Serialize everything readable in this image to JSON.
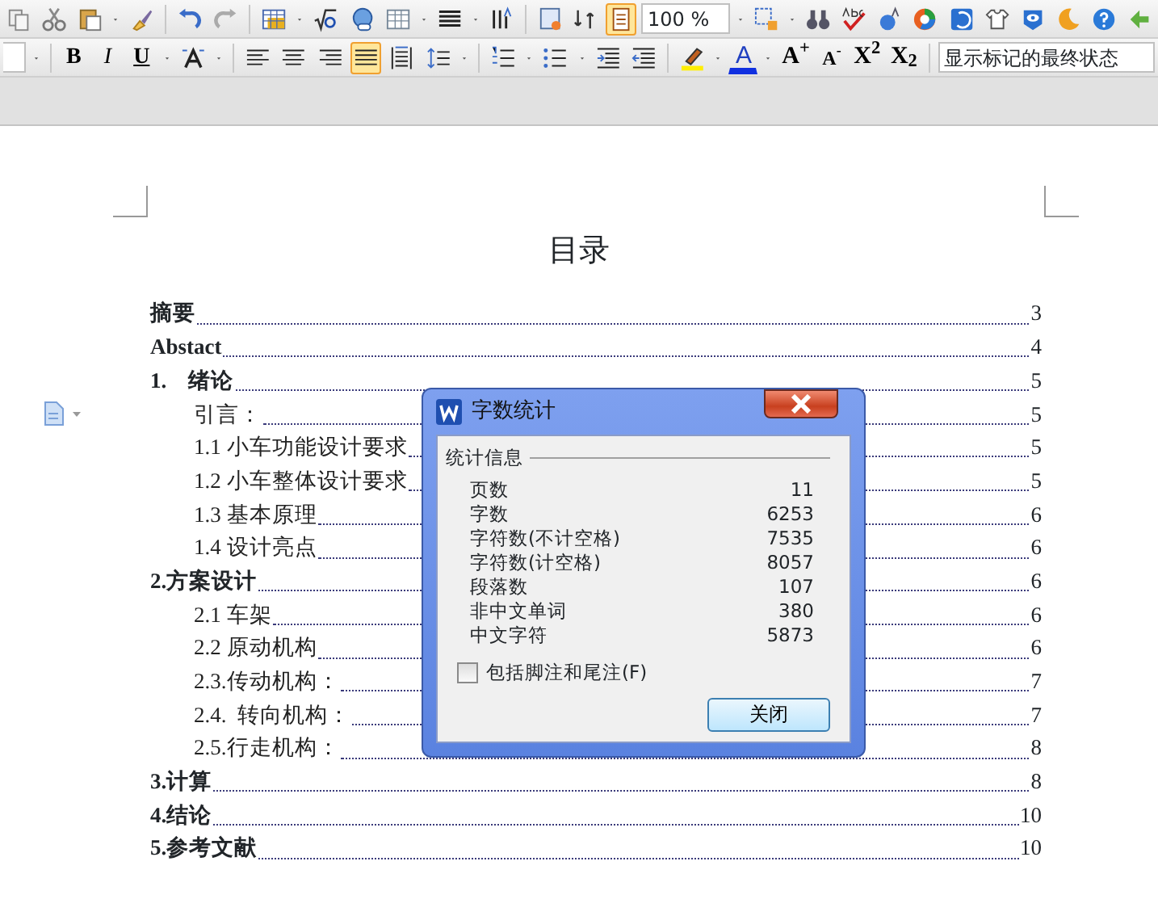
{
  "toolbar_1": {
    "zoom": "100 %"
  },
  "toolbar_2": {
    "format_buttons": [
      {
        "label": "B",
        "kind": "bold"
      },
      {
        "label": "I",
        "kind": "italic"
      },
      {
        "label": "U",
        "kind": "underline"
      }
    ],
    "justify_selected": true,
    "size_buttons": [
      {
        "label": "A$^{+}$"
      },
      {
        "label": "A$^{-}$"
      },
      {
        "label": "X$^{2}$"
      },
      {
        "label": "X$_{2}$"
      }
    ],
    "color_label": "A",
    "markup_view": "显示标记的最终状态"
  },
  "document": {
    "title": "目录",
    "toc": [
      {
        "text": "摘要",
        "page": "3",
        "kind": "heading"
      },
      {
        "text": "Abstact",
        "page": "4",
        "kind": "heading"
      },
      {
        "text": "1.    绪论",
        "page": "5",
        "kind": "heading"
      },
      {
        "text": "引言：",
        "page": "5",
        "kind": "sub"
      },
      {
        "text": "1.1 小车功能设计要求",
        "page": "5",
        "kind": "sub"
      },
      {
        "text": "1.2 小车整体设计要求",
        "page": "5",
        "kind": "sub"
      },
      {
        "text": "1.3 基本原理",
        "page": "6",
        "kind": "sub"
      },
      {
        "text": "1.4 设计亮点",
        "page": "6",
        "kind": "sub"
      },
      {
        "text": "2.方案设计",
        "page": "6",
        "kind": "heading"
      },
      {
        "text": "2.1 车架",
        "page": "6",
        "kind": "sub"
      },
      {
        "text": "2.2 原动机构",
        "page": "6",
        "kind": "sub"
      },
      {
        "text": "2.3.传动机构：",
        "page": "7",
        "kind": "sub"
      },
      {
        "text": "2.4.  转向机构：",
        "page": "7",
        "kind": "sub"
      },
      {
        "text": "2.5.行走机构：",
        "page": "8",
        "kind": "sub"
      },
      {
        "text": "3.计算",
        "page": "8",
        "kind": "heading"
      },
      {
        "text": "4.结论",
        "page": "10",
        "kind": "heading"
      },
      {
        "text": "5.参考文献",
        "page": "10",
        "kind": "heading"
      }
    ]
  },
  "dialog": {
    "title": "字数统计",
    "group": "统计信息",
    "stats": [
      {
        "label": "页数",
        "value": "11"
      },
      {
        "label": "字数",
        "value": "6253"
      },
      {
        "label": "字符数(不计空格)",
        "value": "7535"
      },
      {
        "label": "字符数(计空格)",
        "value": "8057"
      },
      {
        "label": "段落数",
        "value": "107"
      },
      {
        "label": "非中文单词",
        "value": "380"
      },
      {
        "label": "中文字符",
        "value": "5873"
      }
    ],
    "include_footnotes": {
      "label": "包括脚注和尾注(F)",
      "checked": false
    },
    "close_button": "关闭"
  }
}
